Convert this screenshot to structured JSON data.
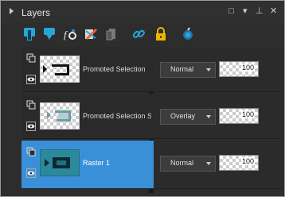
{
  "panel": {
    "title": "Layers"
  },
  "window_controls": {
    "restore": "□",
    "dropdown": "▾",
    "pin": "⊥",
    "close": "✕"
  },
  "toolbar": {
    "icons": [
      "new-raster-layer-icon",
      "new-vector-layer-icon",
      "layer-properties-icon",
      "delete-layer-icon",
      "duplicate-layer-icon",
      "link-layers-icon",
      "lock-icon",
      "mask-icon"
    ]
  },
  "layers": [
    {
      "name": "Promoted Selection",
      "blend": "Normal",
      "opacity": "100",
      "selected": false
    },
    {
      "name": "Promoted Selection Sh",
      "blend": "Overlay",
      "opacity": "100",
      "selected": false
    },
    {
      "name": "Raster 1",
      "blend": "Normal",
      "opacity": "100",
      "selected": true
    }
  ],
  "colors": {
    "accent": "#3a90d8",
    "panel_bg": "#2d2d2d",
    "thumb_art": "#1f5a6a"
  }
}
